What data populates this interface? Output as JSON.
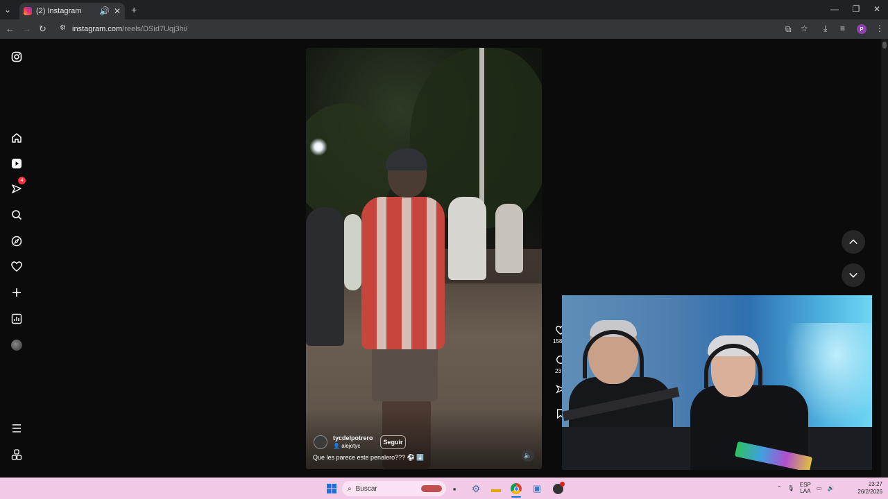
{
  "browser": {
    "tab_title": "(2) Instagram",
    "url_host": "instagram.com",
    "url_path": "/reels/DSid7Uqj3hi/",
    "profile_initial": "P"
  },
  "sidebar": {
    "notification_count": "4",
    "items": [
      "instagram-logo",
      "home",
      "reels",
      "messages",
      "search",
      "explore",
      "notifications",
      "create",
      "dashboard",
      "profile",
      "more",
      "also-from-meta"
    ]
  },
  "reel": {
    "username": "tycdelpotrero",
    "collaborator": "alejotyc",
    "follow_label": "Seguir",
    "caption": "Que les parece este penalero??? ⚽ ⬇️",
    "likes_count": "158",
    "comments_count": "23"
  },
  "taskbar": {
    "search_placeholder": "Buscar",
    "language": "ESP",
    "language_sub": "LAA",
    "time": "23:27",
    "date": "26/2/2026"
  },
  "colors": {
    "accent": "#ff3040",
    "taskbar": "#f3cbe8",
    "page_bg": "#0b0b0b"
  }
}
